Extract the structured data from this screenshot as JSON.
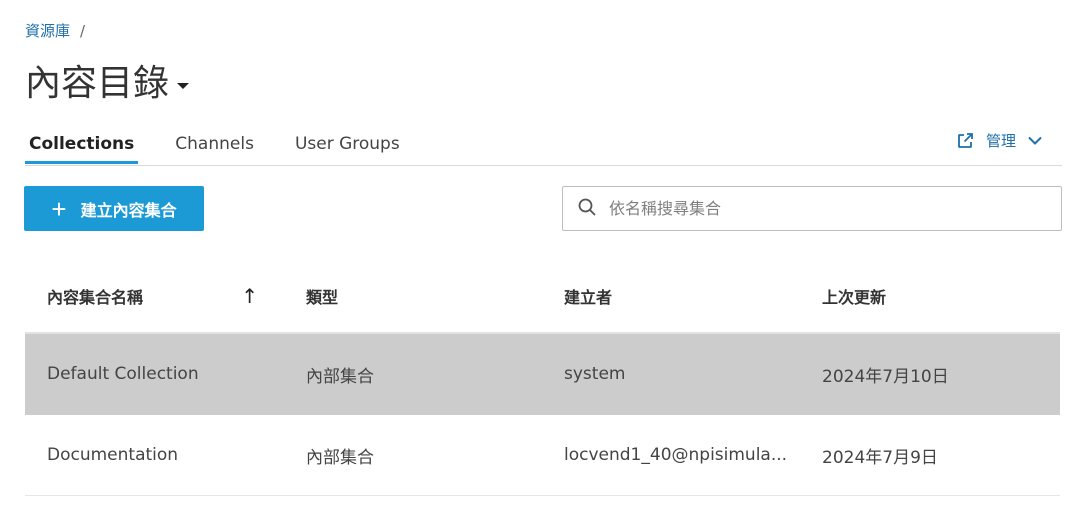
{
  "breadcrumb": {
    "root": "資源庫",
    "separator": "/"
  },
  "page_title": "內容目錄",
  "tabs": [
    {
      "label": "Collections",
      "active": true
    },
    {
      "label": "Channels",
      "active": false
    },
    {
      "label": "User Groups",
      "active": false
    }
  ],
  "manage": {
    "label": "管理",
    "icon": "external-link-icon"
  },
  "create_button": {
    "icon": "plus-icon",
    "label": "建立內容集合"
  },
  "search": {
    "placeholder": "依名稱搜尋集合",
    "value": ""
  },
  "table": {
    "columns": [
      "內容集合名稱",
      "類型",
      "建立者",
      "上次更新"
    ],
    "sort_icon": "arrow-up-icon",
    "rows": [
      {
        "name": "Default Collection",
        "type": "內部集合",
        "creator": "system",
        "updated": "2024年7月10日",
        "selected": true
      },
      {
        "name": "Documentation",
        "type": "內部集合",
        "creator": "locvend1_40@npisimula...",
        "updated": "2024年7月9日",
        "selected": false
      }
    ]
  },
  "colors": {
    "accent": "#1b9ad6",
    "link": "#1f6fa8",
    "selected_row": "#cccccc"
  }
}
